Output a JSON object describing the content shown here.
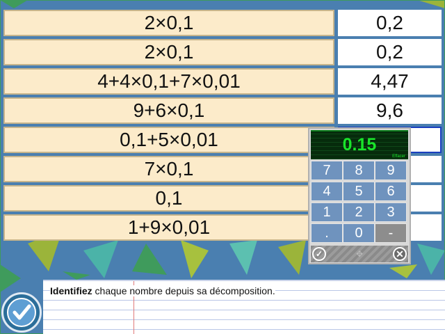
{
  "exercise": {
    "rows": [
      {
        "expression": "2×0,1",
        "answer": "0,2"
      },
      {
        "expression": "2×0,1",
        "answer": "0,2"
      },
      {
        "expression": "4+4×0,1+7×0,01",
        "answer": "4,47"
      },
      {
        "expression": "9+6×0,1",
        "answer": "9,6"
      },
      {
        "expression": "0,1+5×0,01",
        "answer": ""
      },
      {
        "expression": "7×0,1",
        "answer": ""
      },
      {
        "expression": "0,1",
        "answer": ""
      },
      {
        "expression": "1+9×0,01",
        "answer": ""
      }
    ]
  },
  "keypad": {
    "display_value": "0.15",
    "clear_label": "Effacer",
    "keys": [
      "7",
      "8",
      "9",
      "4",
      "5",
      "6",
      "1",
      "2",
      "3",
      ".",
      "0",
      "-"
    ]
  },
  "instruction": {
    "bold": "Identifiez",
    "rest": " chaque nombre depuis sa décomposition."
  },
  "colors": {
    "background": "#4a7fb0",
    "expression_cell": "#fcebca",
    "display_text": "#19e52a",
    "keypad_key": "#6f93be",
    "active_border": "#1a3fbf"
  }
}
